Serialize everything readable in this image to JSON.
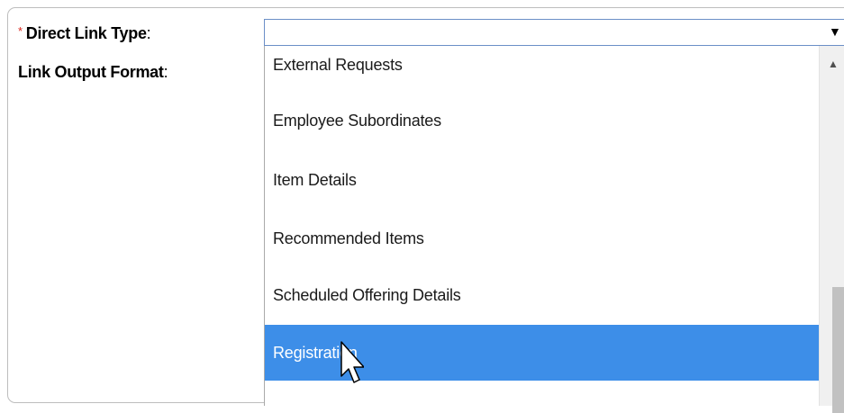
{
  "form": {
    "direct_link_type": {
      "required_marker": "*",
      "label": "Direct Link Type",
      "colon": ":",
      "value": ""
    },
    "link_output_format": {
      "label": "Link Output Format",
      "colon": ":"
    }
  },
  "dropdown": {
    "arrow_icon": "triangle-down-icon",
    "options": [
      "External Requests",
      "Employee Subordinates",
      "Item Details",
      "Recommended Items",
      "Scheduled Offering Details",
      "Registration"
    ],
    "selected_index": 5
  },
  "colors": {
    "selection": "#3d8ee8",
    "required": "#d9261c",
    "border": "#6b8fc7"
  }
}
